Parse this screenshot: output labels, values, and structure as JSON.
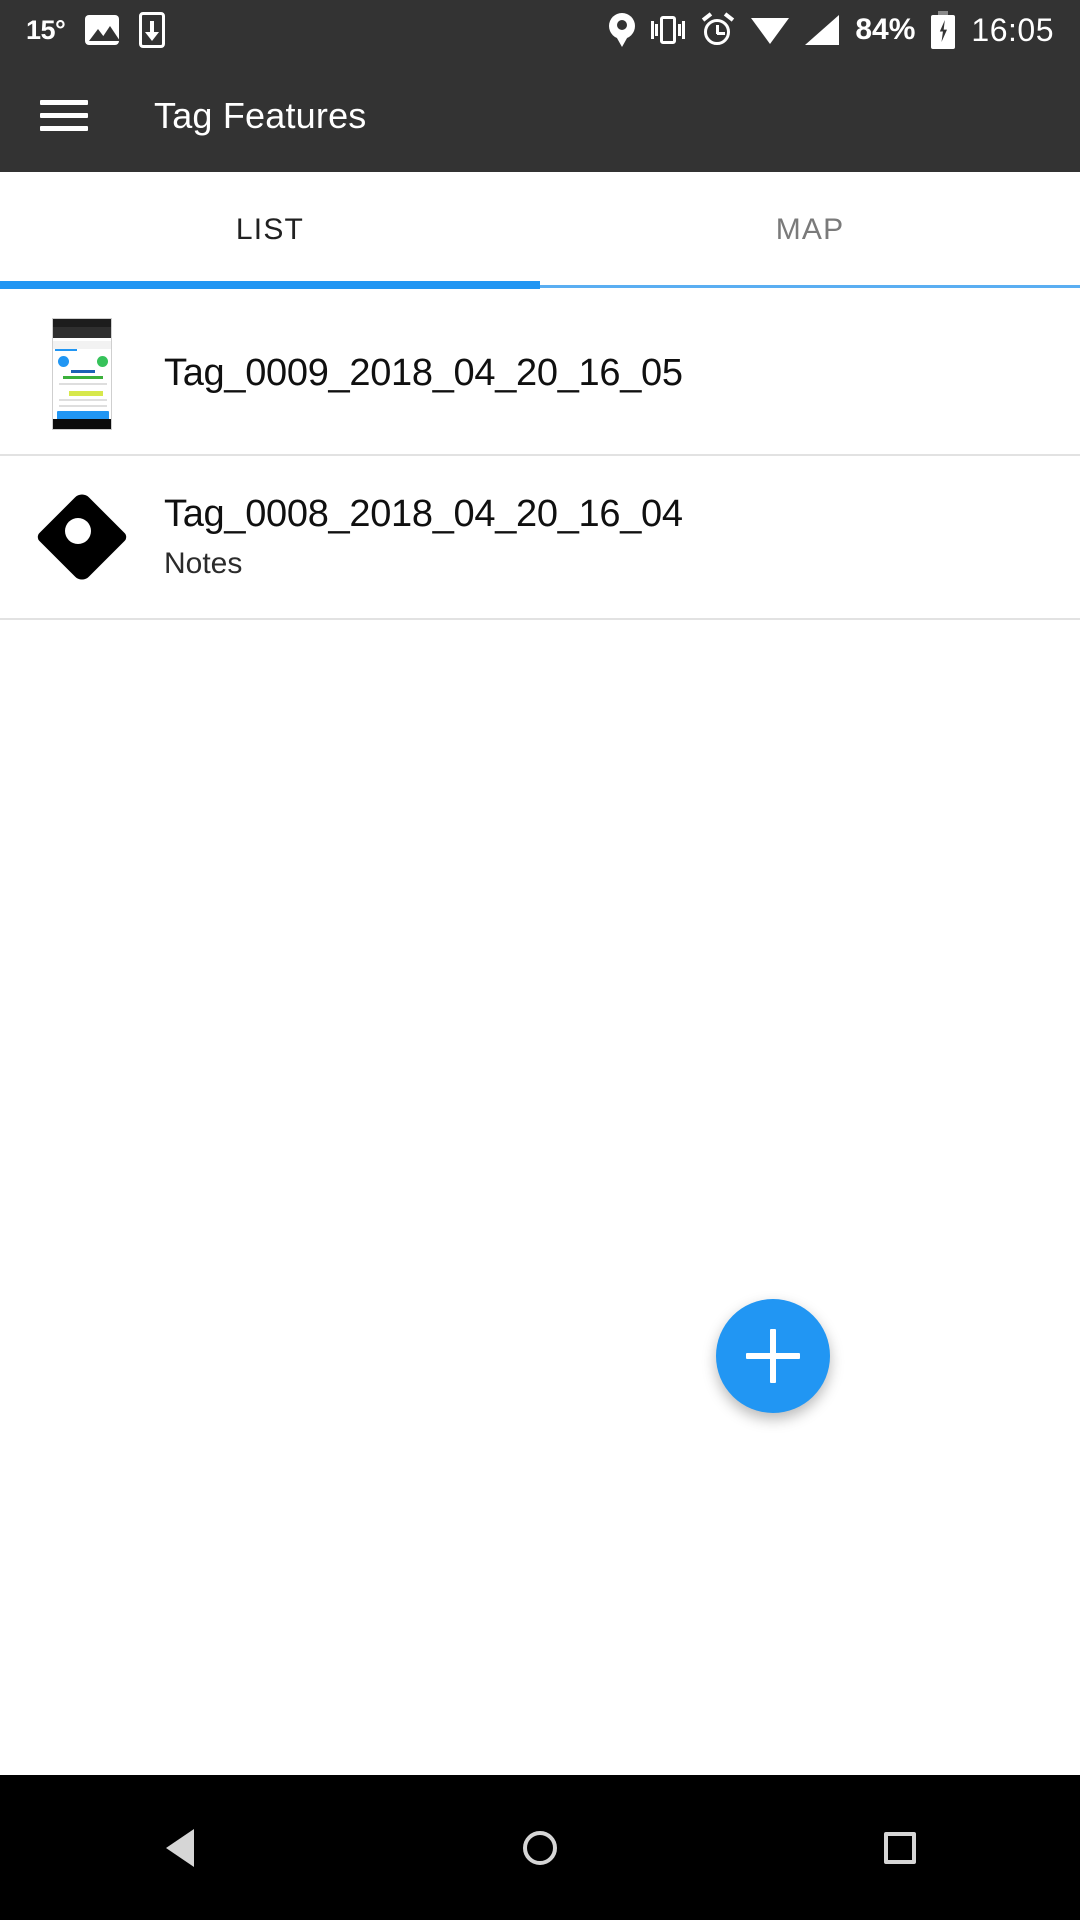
{
  "status_bar": {
    "temperature": "15°",
    "battery_percent": "84%",
    "time": "16:05",
    "icons": {
      "photo": "photo-icon",
      "download_to_phone": "phone-download-icon",
      "location": "location-pin-icon",
      "vibrate": "vibrate-icon",
      "alarm": "alarm-clock-icon",
      "wifi": "wifi-icon",
      "signal": "cellular-signal-icon",
      "battery": "battery-charging-icon"
    },
    "background_color": "#333333",
    "foreground_color": "#ffffff"
  },
  "app_bar": {
    "menu_icon": "hamburger-menu-icon",
    "title": "Tag Features",
    "background_color": "#333333"
  },
  "tabs": {
    "items": [
      {
        "label": "LIST",
        "active": true
      },
      {
        "label": "MAP",
        "active": false
      }
    ],
    "indicator_color": "#2196f3",
    "underline_color": "#5aaef2",
    "active_text_color": "#212121",
    "inactive_text_color": "#7a7a7a"
  },
  "list": {
    "items": [
      {
        "title": "Tag_0009_2018_04_20_16_05",
        "subtitle": "",
        "icon": "screenshot-thumbnail"
      },
      {
        "title": "Tag_0008_2018_04_20_16_04",
        "subtitle": "Notes",
        "icon": "tag-icon"
      }
    ]
  },
  "fab": {
    "icon": "plus-icon",
    "label": "+",
    "color": "#2196f3"
  },
  "nav_bar": {
    "background_color": "#000000",
    "buttons": [
      {
        "name": "back",
        "icon": "back-triangle-icon"
      },
      {
        "name": "home",
        "icon": "home-circle-icon"
      },
      {
        "name": "recents",
        "icon": "recents-square-icon"
      }
    ]
  }
}
